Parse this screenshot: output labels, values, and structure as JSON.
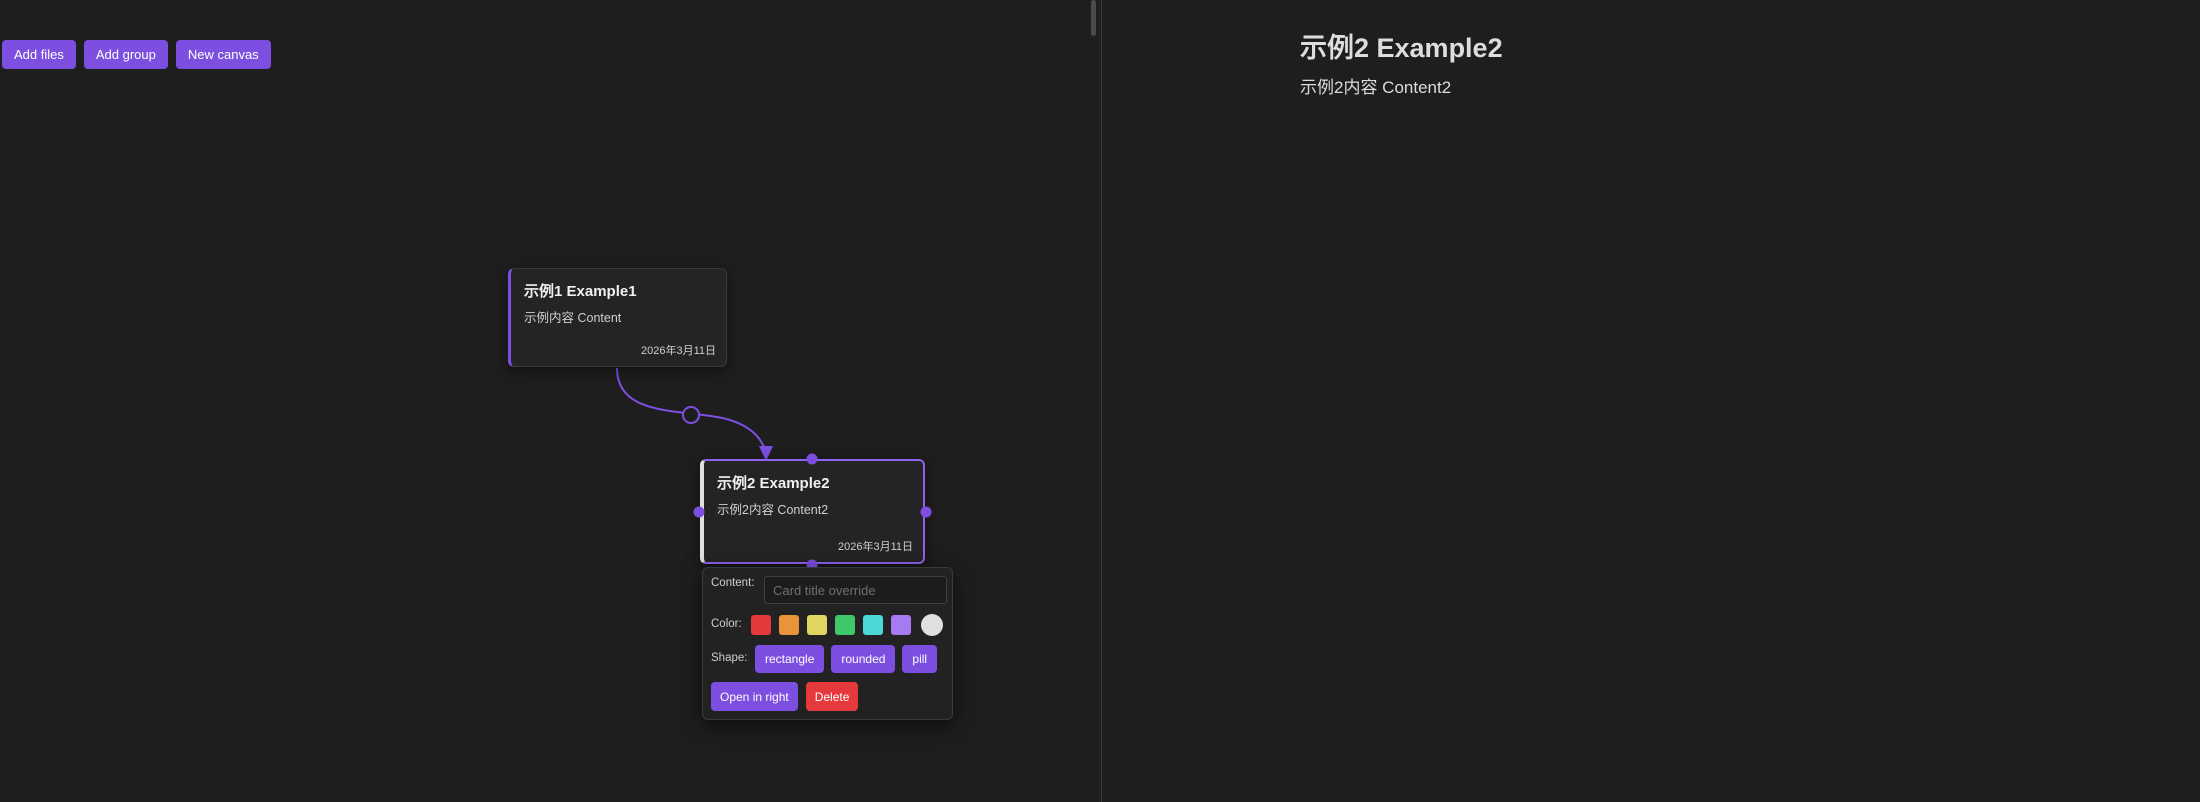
{
  "toolbar": {
    "add_files": "Add files",
    "add_group": "Add group",
    "new_canvas": "New canvas"
  },
  "cards": [
    {
      "title": "示例1 Example1",
      "content": "示例内容 Content",
      "date": "2026年3月11日",
      "selected": false
    },
    {
      "title": "示例2 Example2",
      "content": "示例2内容 Content2",
      "date": "2026年3月11日",
      "selected": true
    }
  ],
  "popup": {
    "content_label": "Content:",
    "content_placeholder": "Card title override",
    "content_value": "",
    "color_label": "Color:",
    "colors": [
      {
        "name": "red",
        "hex": "#e5393e"
      },
      {
        "name": "orange",
        "hex": "#e8943a"
      },
      {
        "name": "yellow",
        "hex": "#e0d560"
      },
      {
        "name": "green",
        "hex": "#3fc86a"
      },
      {
        "name": "cyan",
        "hex": "#4ad8d8"
      },
      {
        "name": "purple",
        "hex": "#a67af0"
      },
      {
        "name": "clear",
        "hex": "#e0e0e0"
      }
    ],
    "shape_label": "Shape:",
    "shapes": [
      "rectangle",
      "rounded",
      "pill"
    ],
    "open_right": "Open in right",
    "delete": "Delete"
  },
  "preview": {
    "title": "示例2 Example2",
    "content": "示例2内容 Content2"
  },
  "theme": {
    "accent": "#7c4fe0",
    "danger": "#e5393e",
    "background": "#1e1e1e"
  }
}
